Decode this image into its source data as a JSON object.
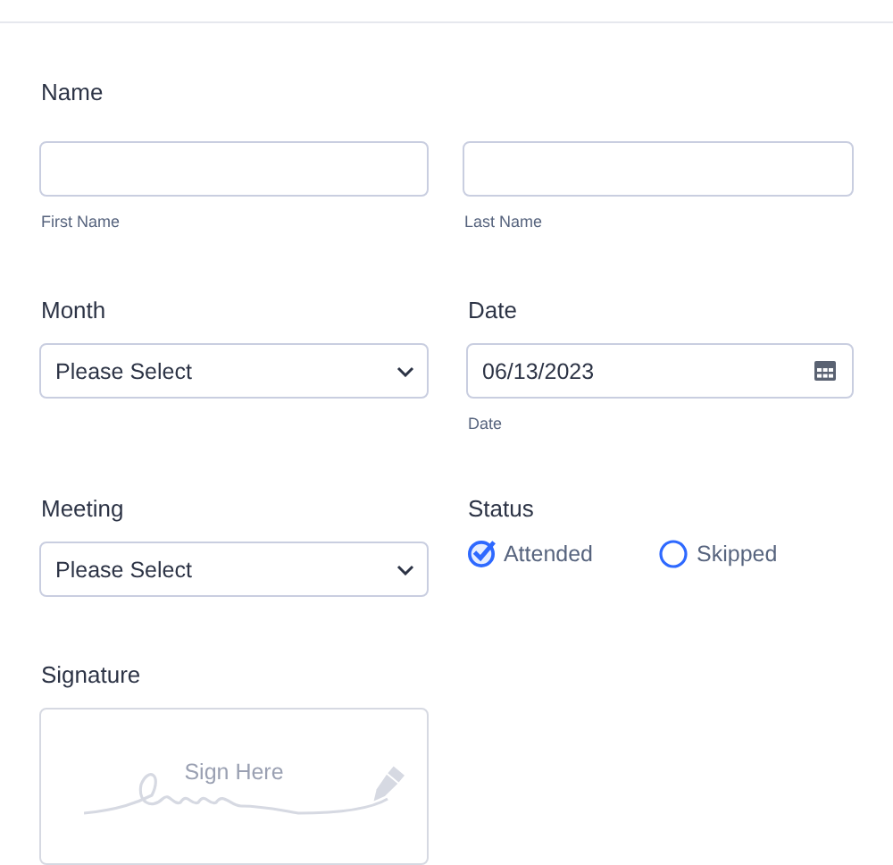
{
  "name": {
    "label": "Name",
    "fields": [
      {
        "sublabel": "First Name"
      },
      {
        "sublabel": "Last Name"
      }
    ]
  },
  "month": {
    "label": "Month",
    "value": "Please Select"
  },
  "date": {
    "label": "Date",
    "value": "06/13/2023",
    "sublabel": "Date"
  },
  "meeting": {
    "label": "Meeting",
    "value": "Please Select"
  },
  "status": {
    "label": "Status",
    "options": [
      {
        "label": "Attended",
        "selected": true
      },
      {
        "label": "Skipped",
        "selected": false
      }
    ]
  },
  "signature": {
    "label": "Signature",
    "placeholder": "Sign Here"
  }
}
